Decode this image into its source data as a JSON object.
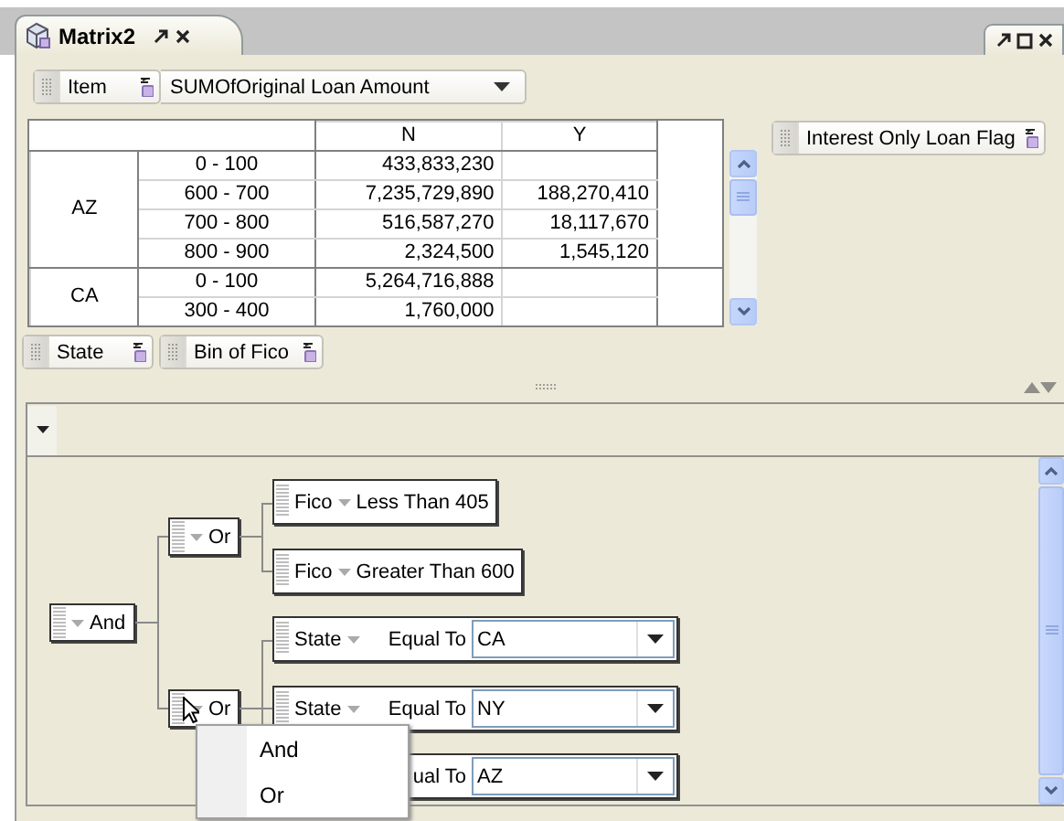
{
  "tab": {
    "title": "Matrix2"
  },
  "pivot": {
    "data_field": "Item",
    "measure": "SUMOfOriginal Loan Amount",
    "column_field": "Interest Only Loan Flag",
    "row_fields": [
      "State",
      "Bin of Fico"
    ],
    "columns": [
      "N",
      "Y"
    ],
    "rows": [
      {
        "state": "AZ",
        "bins": [
          {
            "bin": "0 - 100",
            "values": [
              "433,833,230"
            ]
          },
          {
            "bin": "600 - 700",
            "values": [
              "7,235,729,890",
              "188,270,410"
            ]
          },
          {
            "bin": "700 - 800",
            "values": [
              "516,587,270",
              "18,117,670"
            ]
          },
          {
            "bin": "800 - 900",
            "values": [
              "2,324,500",
              "1,545,120"
            ]
          }
        ]
      },
      {
        "state": "CA",
        "bins": [
          {
            "bin": "0 - 100",
            "values": [
              "5,264,716,888"
            ]
          },
          {
            "bin": "300 - 400",
            "values": [
              "1,760,000"
            ]
          }
        ]
      }
    ]
  },
  "filter": {
    "root": {
      "kind": "group",
      "operator": "And",
      "children": [
        {
          "kind": "group",
          "operator": "Or",
          "children": [
            {
              "kind": "value",
              "field": "Fico",
              "operator": "Less Than",
              "value": "405"
            },
            {
              "kind": "value",
              "field": "Fico",
              "operator": "Greater Than",
              "value": "600"
            }
          ]
        },
        {
          "kind": "group",
          "operator": "Or",
          "children": [
            {
              "kind": "choice",
              "field": "State",
              "operator": "Equal To",
              "value": "CA"
            },
            {
              "kind": "choice",
              "field": "State",
              "operator": "Equal To",
              "value": "NY"
            },
            {
              "kind": "choice",
              "operator": "ual To",
              "value": "AZ"
            }
          ]
        }
      ]
    },
    "menu": {
      "items": [
        "And",
        "Or"
      ]
    }
  }
}
